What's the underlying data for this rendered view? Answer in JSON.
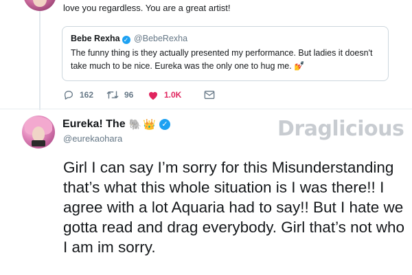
{
  "previous_tweet": {
    "text_tail": "love you regardless. You are a great artist!",
    "quoted_tweet": {
      "name": "Bebe Rexha",
      "handle": "@BebeRexha",
      "text": "The funny thing is they actually presented my performance. But ladies it doesn't take much to be nice. Eureka was the only one to hug me. 💅"
    },
    "actions": {
      "reply_count": "162",
      "retweet_count": "96",
      "like_count": "1.0K"
    }
  },
  "tweet": {
    "author_name": "Eureka! The",
    "author_emoji_1": "🐘",
    "author_emoji_2": "👑",
    "handle": "@eurekaohara",
    "text": "Girl I can say I’m sorry for this Misunderstanding that’s what this whole situation is I was there!! I agree with a lot Aquaria had to say!! But I hate we gotta read and drag everybody. Girl that’s not who I am im sorry."
  },
  "watermark": "Draglicious",
  "colors": {
    "accent_blue": "#1da1f2",
    "like_red": "#e0245e",
    "muted_gray": "#657786"
  },
  "icons": [
    "reply-icon",
    "retweet-icon",
    "heart-icon",
    "mail-icon",
    "verified-icon"
  ]
}
